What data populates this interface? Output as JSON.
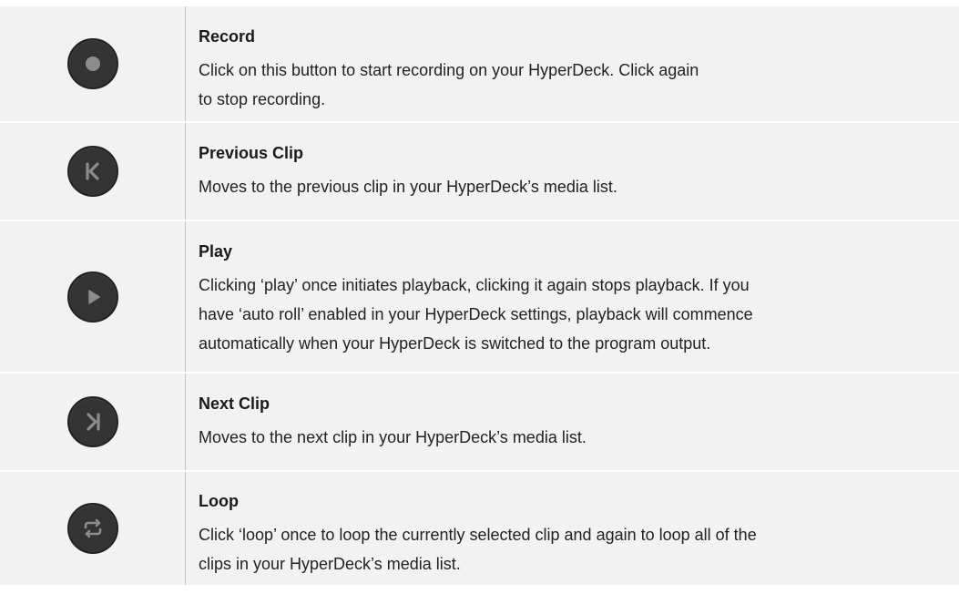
{
  "controls": [
    {
      "icon": "record-icon",
      "title": "Record",
      "desc_lines": [
        "Click on this button to start recording on your HyperDeck. Click again",
        "to stop recording."
      ]
    },
    {
      "icon": "previous-clip-icon",
      "title": "Previous Clip",
      "desc_lines": [
        "Moves to the previous clip in your HyperDeck’s media list."
      ]
    },
    {
      "icon": "play-icon",
      "title": "Play",
      "desc_lines": [
        "Clicking ‘play’ once initiates playback, clicking it again stops playback. If you",
        "have ‘auto roll’ enabled in your HyperDeck settings, playback will commence",
        "automatically when your HyperDeck is switched to the program output."
      ]
    },
    {
      "icon": "next-clip-icon",
      "title": "Next Clip",
      "desc_lines": [
        "Moves to the next clip in your HyperDeck’s media list."
      ]
    },
    {
      "icon": "loop-icon",
      "title": "Loop",
      "desc_lines": [
        "Click ‘loop’ once to loop the currently selected clip and again to loop all of the",
        "clips in your HyperDeck’s media list."
      ]
    }
  ],
  "colors": {
    "row_background": "#f2f2f2",
    "button_fill": "#333333",
    "icon_grey": "#8c8c8c",
    "text": "#222222",
    "divider": "#c4c4c4"
  }
}
